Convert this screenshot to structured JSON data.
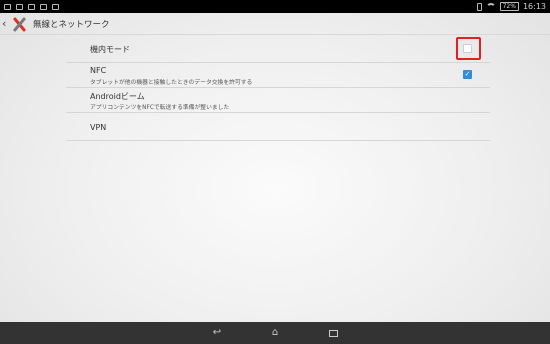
{
  "status_bar": {
    "time": "16:13",
    "battery": "72%"
  },
  "action_bar": {
    "title": "無線とネットワーク"
  },
  "settings": [
    {
      "title": "機内モード",
      "subtitle": "",
      "checked": false
    },
    {
      "title": "NFC",
      "subtitle": "タブレットが他の機器と接触したときのデータ交換を許可する",
      "checked": true
    },
    {
      "title": "Androidビーム",
      "subtitle": "アプリコンテンツをNFCで転送する準備が整いました"
    },
    {
      "title": "VPN"
    }
  ],
  "nav_bar": {
    "back": "↩",
    "home": "⌂"
  },
  "colors": {
    "highlight": "#e22222",
    "check_on": "#2f8ddb",
    "navbar": "#333333"
  }
}
